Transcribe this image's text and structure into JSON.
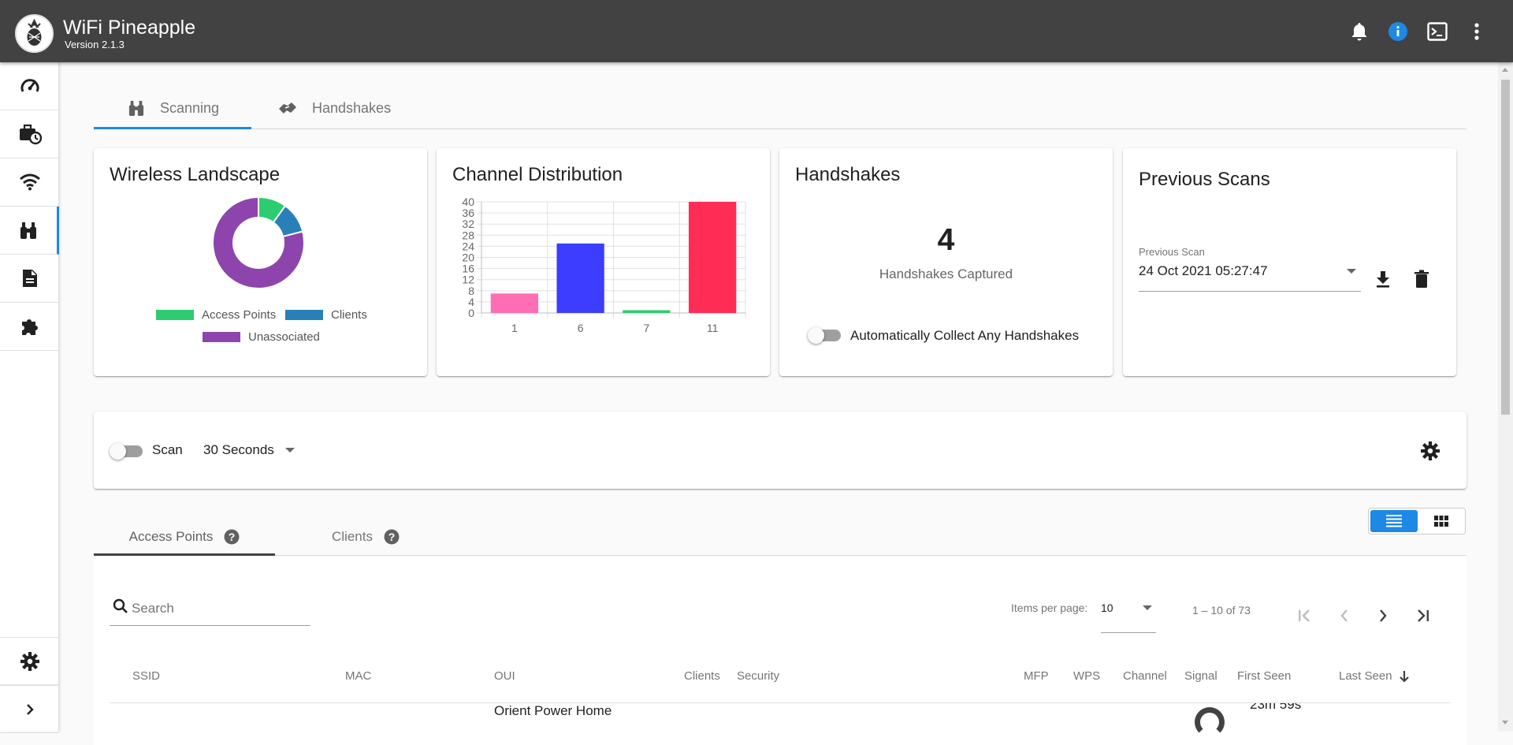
{
  "app": {
    "title": "WiFi Pineapple",
    "version": "Version 2.1.3"
  },
  "topbar": {
    "icons": [
      "bell-icon",
      "info-icon",
      "terminal-icon",
      "more-vert-icon"
    ]
  },
  "sidebar": {
    "items": [
      {
        "icon": "dashboard-speedometer-icon",
        "active": false
      },
      {
        "icon": "campaigns-briefcase-icon",
        "active": false
      },
      {
        "icon": "wifi-icon",
        "active": false
      },
      {
        "icon": "recon-binoculars-icon",
        "active": true
      },
      {
        "icon": "reports-document-icon",
        "active": false
      },
      {
        "icon": "modules-puzzle-icon",
        "active": false
      }
    ],
    "bottom": [
      "settings-gear-icon",
      "expand-chevron-icon"
    ]
  },
  "tabs": [
    {
      "label": "Scanning",
      "icon": "binoculars-icon",
      "active": true
    },
    {
      "label": "Handshakes",
      "icon": "handshake-icon",
      "active": false
    }
  ],
  "wireless_landscape": {
    "title": "Wireless Landscape",
    "legend": [
      {
        "label": "Access Points",
        "color": "#2ecc71"
      },
      {
        "label": "Clients",
        "color": "#2980b9"
      },
      {
        "label": "Unassociated",
        "color": "#8e44ad"
      }
    ]
  },
  "channel_distribution": {
    "title": "Channel Distribution"
  },
  "handshakes": {
    "title": "Handshakes",
    "count": "4",
    "caption": "Handshakes Captured",
    "toggle_label": "Automatically Collect Any Handshakes",
    "toggle_on": false
  },
  "previous_scans": {
    "title": "Previous Scans",
    "field_label": "Previous Scan",
    "value": "24 Oct 2021 05:27:47"
  },
  "scan_bar": {
    "toggle_label": "Scan",
    "toggle_on": false,
    "duration": "30 Seconds"
  },
  "results": {
    "tabs": [
      {
        "label": "Access Points",
        "active": true
      },
      {
        "label": "Clients",
        "active": false
      }
    ],
    "view_mode": "list",
    "search_placeholder": "Search",
    "items_per_page_label": "Items per page:",
    "items_per_page": "10",
    "range": "1 – 10 of 73",
    "columns": [
      "SSID",
      "MAC",
      "OUI",
      "Clients",
      "Security",
      "MFP",
      "WPS",
      "Channel",
      "Signal",
      "First Seen",
      "Last Seen"
    ],
    "sorted_column": "Last Seen",
    "sort_direction": "descending",
    "first_row_visible": {
      "oui": "Orient Power Home",
      "first_seen": "23m 59s"
    }
  },
  "chart_data": [
    {
      "type": "pie",
      "title": "Wireless Landscape",
      "donut": true,
      "categories": [
        "Access Points",
        "Clients",
        "Unassociated"
      ],
      "values": [
        10,
        11,
        79
      ],
      "colors": [
        "#2ecc71",
        "#2980b9",
        "#8e44ad"
      ],
      "legend": "bottom"
    },
    {
      "type": "bar",
      "title": "Channel Distribution",
      "categories": [
        "1",
        "6",
        "7",
        "11"
      ],
      "values": [
        7,
        25,
        1,
        40
      ],
      "colors": [
        "#ff6eb4",
        "#3d3dff",
        "#2ecc71",
        "#ff2d55"
      ],
      "ylim": [
        0,
        40
      ],
      "yticks": [
        0,
        4,
        8,
        12,
        16,
        20,
        24,
        28,
        32,
        36,
        40
      ],
      "grid": true,
      "xlabel": "",
      "ylabel": ""
    }
  ]
}
